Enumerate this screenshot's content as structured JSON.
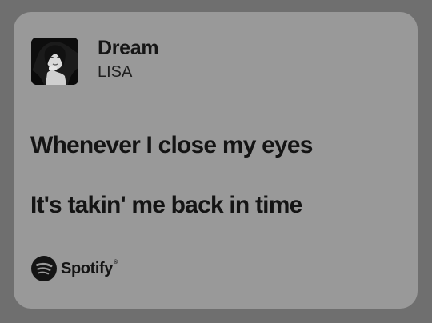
{
  "track": {
    "title": "Dream",
    "artist": "LISA"
  },
  "lyrics": [
    "Whenever I close my eyes",
    "It's takin' me back in time"
  ],
  "brand": {
    "name": "Spotify",
    "tm": "®",
    "icon": "spotify-logo-icon"
  },
  "colors": {
    "page_background": "#6f6f6f",
    "card_background": "#999999",
    "text": "#141414"
  }
}
